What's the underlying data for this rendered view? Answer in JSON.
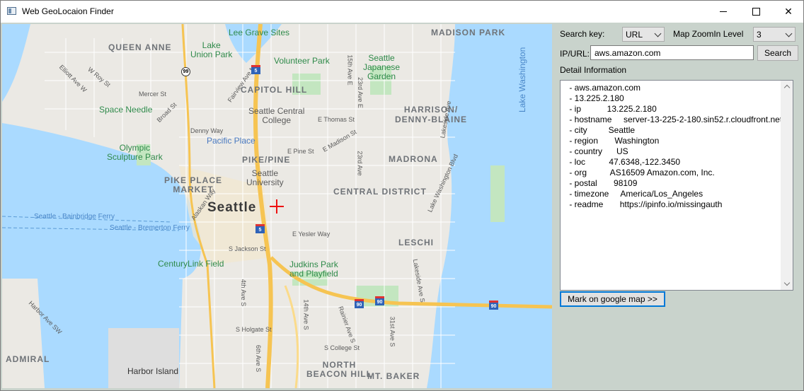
{
  "window": {
    "title": "Web GeoLocaion Finder",
    "controls": {
      "minimize": "minimize-icon",
      "maximize": "maximize-icon",
      "close": "close-icon"
    }
  },
  "map": {
    "city": "Seattle",
    "districts": [
      "QUEEN ANNE",
      "CAPITOL HILL",
      "MADISON PARK",
      "HARRISON/\nDENNY-BLAINE",
      "PIKE/PINE",
      "MADRONA",
      "PIKE PLACE\nMARKET",
      "CENTRAL DISTRICT",
      "LESCHI",
      "NORTH\nBEACON HILL",
      "MT. BAKER",
      "ADMIRAL"
    ],
    "parks": [
      "Lake\nUnion Park",
      "Volunteer Park",
      "Seattle\nJapanese\nGarden",
      "Olympic\nSculpture Park",
      "CenturyLink Field",
      "Judkins Park\nand Playfield",
      "Lee Grave Sites",
      "Space Needle"
    ],
    "pois": [
      "Pacific Place",
      "Seattle Central\nCollege",
      "Seattle\nUniversity",
      "Harbor Island"
    ],
    "water": [
      "Lake Washington",
      "Seattle - Bainbridge Ferry",
      "Seattle - Bremerton Ferry"
    ],
    "streets": [
      "Mercer St",
      "Denny Way",
      "E Pine St",
      "E Madison St",
      "E Thomas St",
      "15th Ave E",
      "23rd Ave E",
      "23rd Ave",
      "E Yesler Way",
      "S Jackson St",
      "S Holgate St",
      "4th Ave S",
      "6th Ave S",
      "14th Ave S",
      "Rainier Ave S",
      "31st Ave S",
      "S College St",
      "Lakeside Ave S",
      "Harbor Ave SW",
      "Elliott Ave W",
      "W Roy St",
      "Fairview Ave N",
      "Lake Washington Blvd",
      "Lakeside Ave",
      "Broad St",
      "Alaskan Way"
    ],
    "shields": [
      "99",
      "5",
      "5",
      "90",
      "90",
      "90"
    ],
    "marker": "red-crosshair"
  },
  "panel": {
    "search_key_label": "Search key:",
    "search_key_value": "URL",
    "zoom_label": "Map ZoomIn Level",
    "zoom_value": "3",
    "ipurl_label": "IP/URL:",
    "ipurl_value": "aws.amazon.com",
    "search_button": "Search",
    "detail_label": "Detail Information",
    "detail_lines": [
      " - aws.amazon.com",
      " - 13.225.2.180",
      " - ip           13.225.2.180",
      " - hostname     server-13-225-2-180.sin52.r.cloudfront.net",
      " - city         Seattle",
      " - region       Washington",
      " - country      US",
      " - loc          47.6348,-122.3450",
      " - org          AS16509 Amazon.com, Inc.",
      " - postal       98109",
      " - timezone     America/Los_Angeles",
      " - readme       https://ipinfo.io/missingauth"
    ],
    "mark_button": "Mark on google map >>"
  },
  "colors": {
    "accent": "#0078d7",
    "water": "#aadaff",
    "park": "#c3e6c0",
    "highway": "#f6c452",
    "marker": "#ee1111"
  }
}
